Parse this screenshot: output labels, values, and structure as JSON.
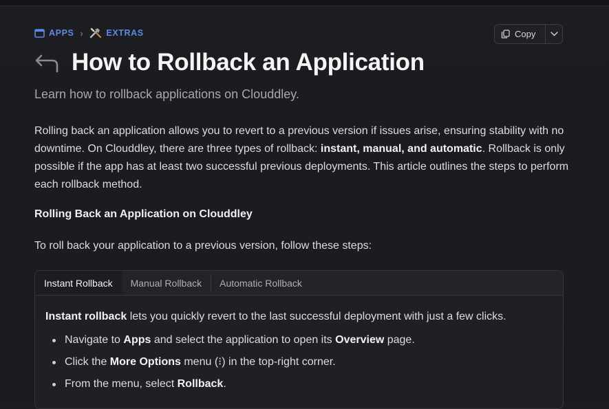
{
  "breadcrumb": {
    "apps_label": "APPS",
    "extras_label": "EXTRAS",
    "separator": "›"
  },
  "copy": {
    "label": "Copy"
  },
  "page": {
    "title": "How to Rollback an Application",
    "subtitle": "Learn how to rollback applications on Clouddley."
  },
  "intro": {
    "part1": "Rolling back an application allows you to revert to a previous version if issues arise, ensuring stability with no downtime. On Clouddley, there are three types of rollback: ",
    "bold": "instant, manual, and automatic",
    "part2": ". Rollback is only possible if the app has at least two successful previous deployments. This article outlines the steps to perform each rollback method."
  },
  "section": {
    "heading": "Rolling Back an Application on Clouddley",
    "steps_intro": "To roll back your application to a previous version, follow these steps:"
  },
  "tabs": [
    {
      "label": "Instant Rollback",
      "active": true
    },
    {
      "label": "Manual Rollback",
      "active": false
    },
    {
      "label": "Automatic Rollback",
      "active": false
    }
  ],
  "instant": {
    "intro_bold": "Instant rollback",
    "intro_rest": " lets you quickly revert to the last successful deployment with just a few clicks.",
    "steps": [
      {
        "a": "Navigate to ",
        "b": "Apps",
        "c": " and select the application to open its ",
        "d": "Overview",
        "e": " page."
      },
      {
        "a": "Click the ",
        "b": "More Options",
        "c": " menu (⁝) in the top-right corner."
      },
      {
        "a": "From the menu, select ",
        "b": "Rollback",
        "c": "."
      }
    ]
  },
  "colors": {
    "accent": "#5b8ae6",
    "background": "#1c1d21",
    "text": "#dcdde0"
  },
  "icons": [
    "app-window-icon",
    "tools-icon",
    "copy-icon",
    "chevron-down-icon",
    "back-arrow-icon"
  ]
}
